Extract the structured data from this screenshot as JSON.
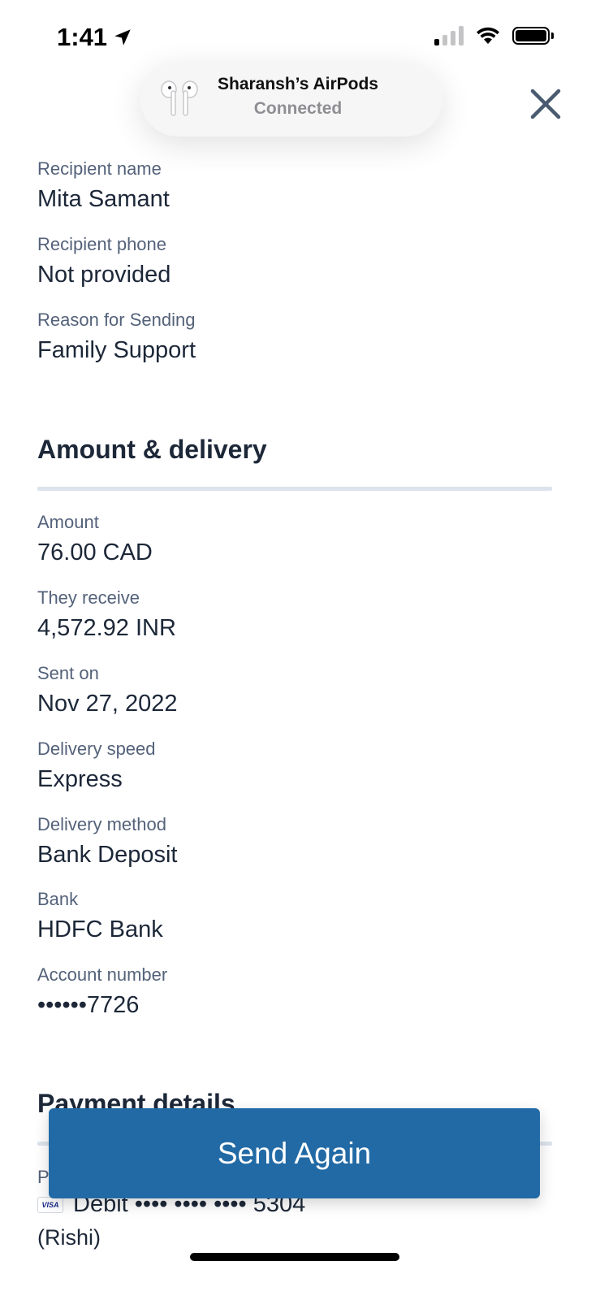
{
  "status_bar": {
    "time": "1:41",
    "icons": [
      "location-arrow-icon",
      "cellular-signal-icon",
      "wifi-icon",
      "battery-icon"
    ]
  },
  "airpods_banner": {
    "device_name": "Sharansh’s AirPods",
    "status": "Connected",
    "icon": "airpods-icon"
  },
  "header": {
    "close_icon": "close-icon"
  },
  "recipient": {
    "fields": [
      {
        "label": "Recipient name",
        "value": "Mita Samant"
      },
      {
        "label": "Recipient phone",
        "value": "Not provided"
      },
      {
        "label": "Reason for Sending",
        "value": "Family Support"
      }
    ]
  },
  "amount_delivery": {
    "title": "Amount & delivery",
    "fields": [
      {
        "label": "Amount",
        "value": "76.00 CAD"
      },
      {
        "label": "They receive",
        "value": "4,572.92 INR"
      },
      {
        "label": "Sent on",
        "value": "Nov 27, 2022"
      },
      {
        "label": "Delivery speed",
        "value": "Express"
      },
      {
        "label": "Delivery method",
        "value": "Bank Deposit"
      },
      {
        "label": "Bank",
        "value": "HDFC Bank"
      },
      {
        "label": "Account number",
        "value": "••••••7726"
      }
    ]
  },
  "payment_details": {
    "title": "Payment details",
    "label_partial": "P",
    "card_brand": "VISA",
    "card_text": "Debit •••• •••• •••• 5304",
    "card_owner": "(Rishi)"
  },
  "actions": {
    "send_again_label": "Send Again"
  },
  "colors": {
    "primary": "#226aa5",
    "text": "#1c2738",
    "label": "#54627a",
    "divider": "#dde3ec"
  }
}
